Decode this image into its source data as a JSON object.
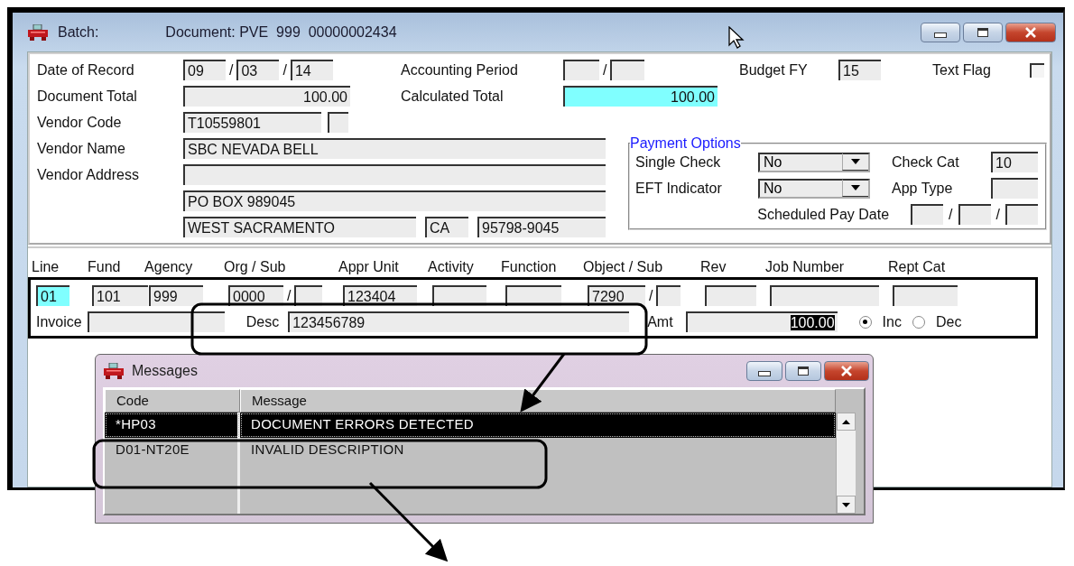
{
  "window": {
    "title": "Batch:",
    "document": "Document: PVE  999  00000002434"
  },
  "header": {
    "date_of_record": {
      "label": "Date of Record",
      "parts": [
        "09",
        "03",
        "14"
      ],
      "separator": "/"
    },
    "accounting_period": {
      "label": "Accounting Period",
      "separator": "/"
    },
    "budget_fy": {
      "label": "Budget FY",
      "value": "15"
    },
    "text_flag": {
      "label": "Text Flag",
      "checked": false
    },
    "document_total": {
      "label": "Document Total",
      "value": "100.00"
    },
    "calculated_total": {
      "label": "Calculated Total",
      "value": "100.00",
      "highlighted": true
    },
    "vendor_code": {
      "label": "Vendor Code",
      "value": "T10559801"
    },
    "vendor_name": {
      "label": "Vendor Name",
      "value": "SBC NEVADA BELL"
    },
    "vendor_address": {
      "label": "Vendor Address",
      "street": "PO BOX 989045",
      "city": "WEST SACRAMENTO",
      "state": "CA",
      "zip": "95798-9045"
    }
  },
  "payment_options": {
    "title": "Payment Options",
    "single_check": {
      "label": "Single Check",
      "value": "No"
    },
    "eft_indicator": {
      "label": "EFT Indicator",
      "value": "No"
    },
    "check_cat": {
      "label": "Check Cat",
      "value": "10"
    },
    "app_type": {
      "label": "App Type"
    },
    "scheduled_pay_date": {
      "label": "Scheduled Pay Date",
      "separator": "/"
    }
  },
  "line": {
    "columns": [
      {
        "label": "Line",
        "kind": "single",
        "value": "01",
        "highlighted": true
      },
      {
        "label": "Fund",
        "kind": "single",
        "value": "101",
        "highlighted": false
      },
      {
        "label": "Agency",
        "kind": "single",
        "value": "999",
        "highlighted": false
      },
      {
        "label": "Org / Sub",
        "kind": "pair",
        "value": "0000",
        "separator": "/",
        "highlighted": false
      },
      {
        "label": "Appr Unit",
        "kind": "single",
        "value": "123404",
        "highlighted": false
      },
      {
        "label": "Activity",
        "kind": "single",
        "highlighted": false
      },
      {
        "label": "Function",
        "kind": "single",
        "highlighted": false
      },
      {
        "label": "Object / Sub",
        "kind": "pair",
        "value": "7290",
        "separator": "/",
        "highlighted": false
      },
      {
        "label": "Rev",
        "kind": "single",
        "highlighted": false
      },
      {
        "label": "Job Number",
        "kind": "single",
        "highlighted": false
      },
      {
        "label": "Rept Cat",
        "kind": "single",
        "highlighted": false
      }
    ],
    "invoice": {
      "label": "Invoice"
    },
    "desc": {
      "label": "Desc",
      "value": "123456789"
    },
    "amt": {
      "label": "Amt",
      "value": "100.00",
      "selected": true
    },
    "direction": [
      {
        "label": "Inc",
        "selected": true
      },
      {
        "label": "Dec",
        "selected": false
      }
    ]
  },
  "messages": {
    "title": "Messages",
    "columns": [
      "Code",
      "Message"
    ],
    "rows": [
      {
        "code": "*HP03",
        "message": "DOCUMENT ERRORS DETECTED",
        "selected": true
      },
      {
        "code": "D01-NT20E",
        "message": "INVALID DESCRIPTION",
        "selected": false
      }
    ]
  }
}
